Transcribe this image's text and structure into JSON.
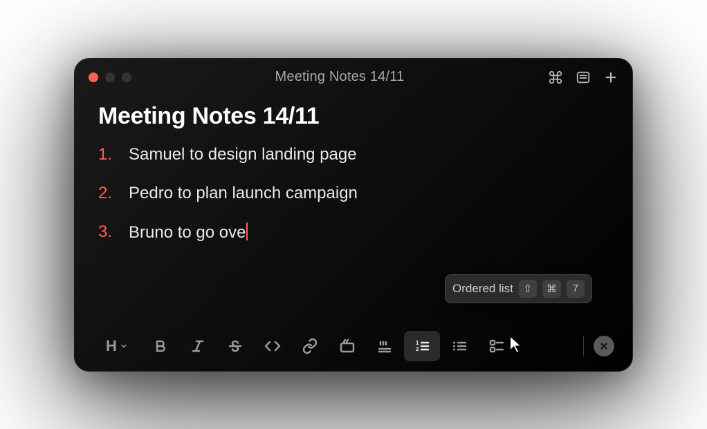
{
  "titlebar": {
    "title": "Meeting Notes 14/11"
  },
  "document": {
    "title": "Meeting Notes 14/11",
    "list": [
      "Samuel to design landing page",
      "Pedro to plan launch campaign",
      "Bruno to go ove"
    ]
  },
  "tooltip": {
    "label": "Ordered list",
    "keys": [
      "⇧",
      "⌘",
      "7"
    ]
  },
  "toolbar": {
    "heading_label": "H"
  },
  "colors": {
    "accent": "#ff6059"
  }
}
